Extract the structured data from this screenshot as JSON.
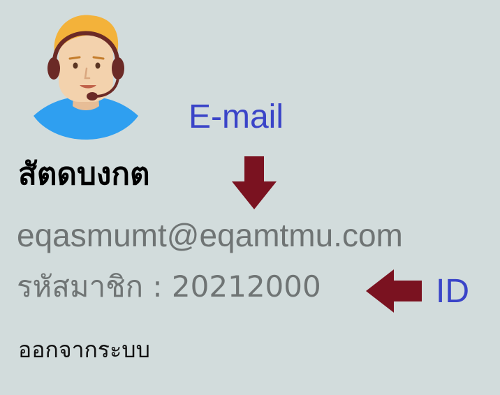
{
  "profile": {
    "username": "สัตดบงกต",
    "email": "eqasmumt@eqamtmu.com",
    "member_id_label": "รหัสมาชิก : 20212000",
    "logout_label": "ออกจากระบบ"
  },
  "annotations": {
    "email_label": "E-mail",
    "id_label": "ID"
  },
  "icons": {
    "avatar": "support-agent-avatar-icon",
    "email_arrow": "arrow-down-icon",
    "id_arrow": "arrow-left-icon"
  },
  "colors": {
    "background": "#d2dcdc",
    "annotation_text": "#3a44c8",
    "arrow": "#7a1220",
    "secondary_text": "#6f7474"
  }
}
